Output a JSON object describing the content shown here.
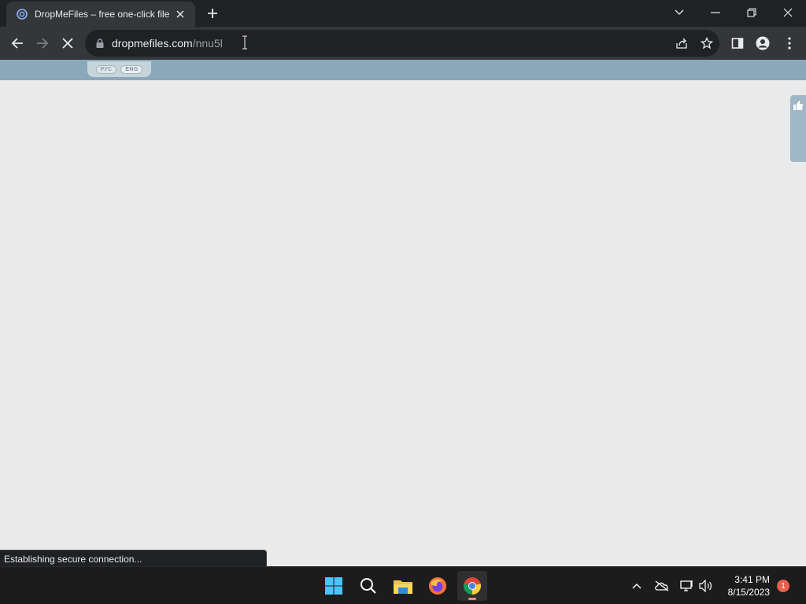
{
  "browser": {
    "tab": {
      "title": "DropMeFiles – free one-click file",
      "favicon": "dropmefiles-logo-icon"
    },
    "url": {
      "domain": "dropmefiles.com",
      "path": "/nnu5l"
    },
    "status": "Establishing secure connection..."
  },
  "page": {
    "languages": [
      {
        "label": "РУС",
        "active": false
      },
      {
        "label": "ENG",
        "active": true
      }
    ],
    "feedback_icon": "thumbs-up-icon"
  },
  "taskbar": {
    "apps": [
      "start-icon",
      "search-icon",
      "file-explorer-icon",
      "firefox-icon",
      "chrome-icon"
    ],
    "active_app": "chrome-icon",
    "clock": {
      "time": "3:41 PM",
      "date": "8/15/2023"
    },
    "notification_count": "1"
  },
  "colors": {
    "header": "#8aa8ba",
    "page_bg": "#eaeaea",
    "taskbar": "#1c1c1c",
    "chrome_dark": "#202124"
  }
}
